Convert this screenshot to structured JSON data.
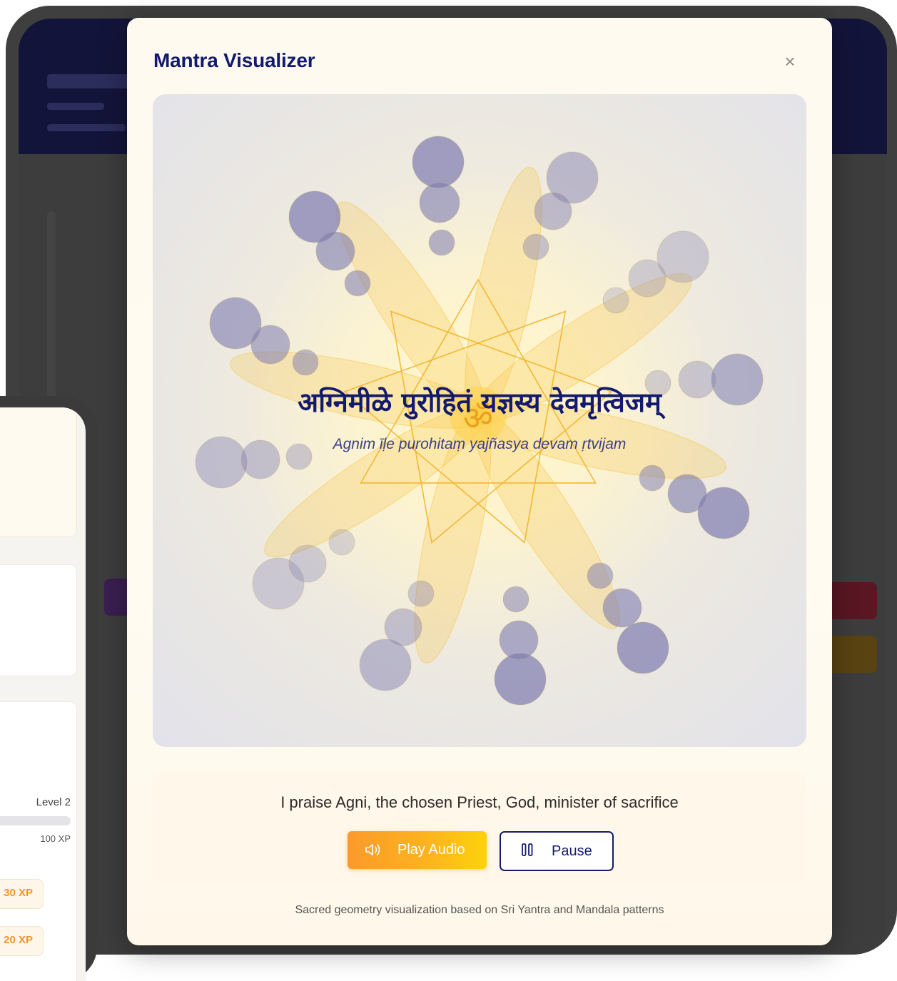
{
  "modal": {
    "title": "Mantra Visualizer",
    "close_label": "×"
  },
  "mantra": {
    "sanskrit": "अग्निमीळे पुरोहितं यज्ञस्य देवमृत्विजम्",
    "transliteration": "Agnim īḷe purohitaṃ yajñasya devam ṛtvijam",
    "om_symbol": "ॐ",
    "translation": "I praise Agni, the chosen Priest, God, minister of sacrifice"
  },
  "controls": {
    "play_label": "Play Audio",
    "play_icon": "speaker-icon",
    "pause_label": "Pause",
    "pause_icon": "pause-icon"
  },
  "footnote": "Sacred geometry visualization based on Sri Yantra and Mandala patterns",
  "background_device": {
    "level_label": "Level 2",
    "level_xp": "100 XP",
    "level_progress": 0.3,
    "xp_badges": [
      "30 XP",
      "20 XP"
    ]
  },
  "colors": {
    "title": "#121a6e",
    "accent_orange": "#fb9a2b",
    "accent_yellow": "#fdd20c",
    "circle_purple": "#7d7bb0",
    "petal_gold": "#f7c64a"
  }
}
